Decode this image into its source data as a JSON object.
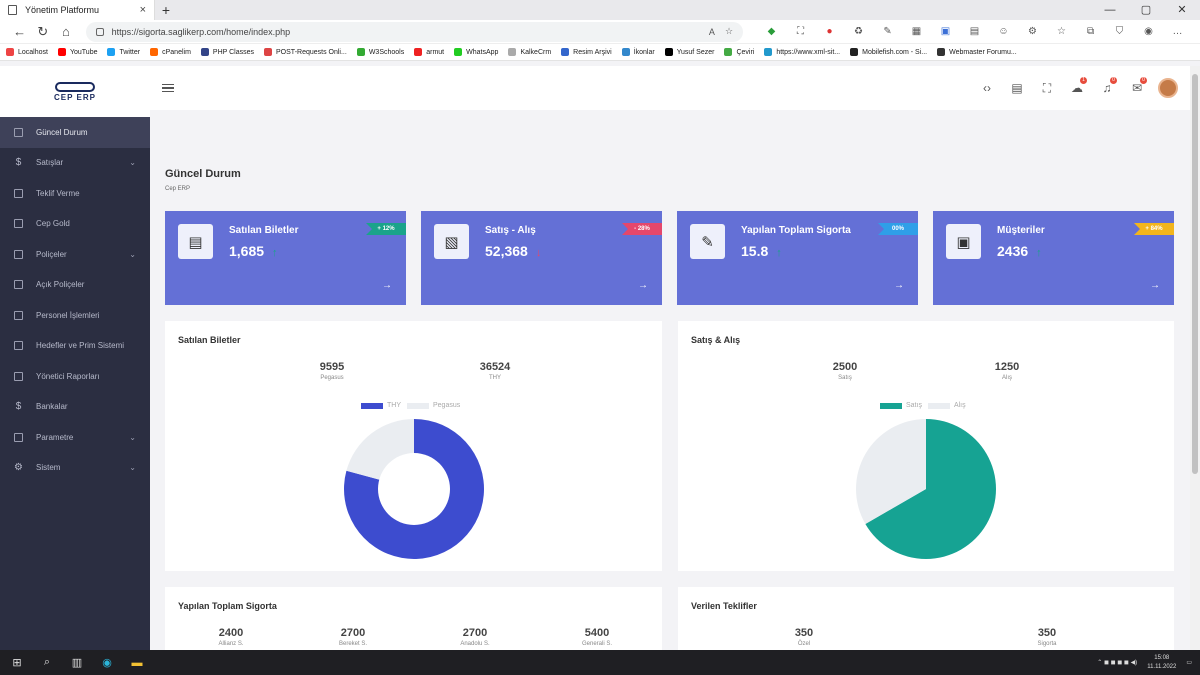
{
  "browser": {
    "tab_title": "Yönetim Platformu",
    "url": "https://sigorta.saglikerp.com/home/index.php",
    "reader_mode": "A",
    "bookmarks": [
      "Localhost",
      "YouTube",
      "Twitter",
      "cPanelim",
      "PHP Classes",
      "POST-Requests Onli...",
      "W3Schools",
      "armut",
      "WhatsApp",
      "KalkeCrm",
      "Resim Arşivi",
      "İkonlar",
      "Yusuf Sezer",
      "Çeviri",
      "https://www.xml-sit...",
      "Mobilefish.com - Si...",
      "Webmaster Forumu..."
    ]
  },
  "app": {
    "logo_text": "CEP ERP",
    "sidebar": [
      {
        "label": "Güncel Durum",
        "icon": "document-icon",
        "chevron": false
      },
      {
        "label": "Satışlar",
        "icon": "dollar-icon",
        "chevron": true
      },
      {
        "label": "Teklif Verme",
        "icon": "document-icon",
        "chevron": false
      },
      {
        "label": "Cep Gold",
        "icon": "document-icon",
        "chevron": false
      },
      {
        "label": "Poliçeler",
        "icon": "document-icon",
        "chevron": true
      },
      {
        "label": "Açık Poliçeler",
        "icon": "document-icon",
        "chevron": false
      },
      {
        "label": "Personel İşlemleri",
        "icon": "document-icon",
        "chevron": false
      },
      {
        "label": "Hedefler ve Prim Sistemi",
        "icon": "document-icon",
        "chevron": false
      },
      {
        "label": "Yönetici Raporları",
        "icon": "document-icon",
        "chevron": false
      },
      {
        "label": "Bankalar",
        "icon": "dollar-icon",
        "chevron": false
      },
      {
        "label": "Parametre",
        "icon": "card-icon",
        "chevron": true
      },
      {
        "label": "Sistem",
        "icon": "gear-icon",
        "chevron": true
      }
    ],
    "topbar_badges": {
      "bell": "0",
      "mail": "0",
      "cloud": "1"
    }
  },
  "page": {
    "title": "Güncel Durum",
    "subtitle": "Cep ERP"
  },
  "cards": [
    {
      "title": "Satılan Biletler",
      "value": "1,685",
      "trend": "↑",
      "badge": "+ 12%",
      "badge_color": "#1aa38a",
      "trend_color": "#1aa38a"
    },
    {
      "title": "Satış - Alış",
      "value": "52,368",
      "trend": "↓",
      "badge": "- 28%",
      "badge_color": "#e5476b",
      "trend_color": "#e5476b"
    },
    {
      "title": "Yapılan Toplam Sigorta",
      "value": "15.8",
      "trend": "↑",
      "badge": "00%",
      "badge_color": "#2f9fe8",
      "trend_color": "#1aa38a"
    },
    {
      "title": "Müşteriler",
      "value": "2436",
      "trend": "↑",
      "badge": "+ 84%",
      "badge_color": "#f2b51d",
      "trend_color": "#1aa38a"
    }
  ],
  "panels": {
    "tickets": {
      "title": "Satılan Biletler",
      "stats": [
        {
          "value": "9595",
          "label": "Pegasus"
        },
        {
          "value": "36524",
          "label": "THY"
        }
      ],
      "legend": [
        {
          "label": "THY",
          "color": "#3d4ccf"
        },
        {
          "label": "Pegasus",
          "color": "#eaedf1"
        }
      ]
    },
    "sales": {
      "title": "Satış & Alış",
      "stats": [
        {
          "value": "2500",
          "label": "Satış"
        },
        {
          "value": "1250",
          "label": "Alış"
        }
      ],
      "legend": [
        {
          "label": "Satış",
          "color": "#16a393"
        },
        {
          "label": "Alış",
          "color": "#eaedf1"
        }
      ]
    },
    "insurance": {
      "title": "Yapılan Toplam Sigorta",
      "stats": [
        {
          "value": "2400",
          "label": "Allianz S."
        },
        {
          "value": "2700",
          "label": "Bereket S."
        },
        {
          "value": "2700",
          "label": "Anadolu S."
        },
        {
          "value": "5400",
          "label": "Generali S."
        }
      ]
    },
    "offers": {
      "title": "Verilen Teklifler",
      "stats": [
        {
          "value": "350",
          "label": "Özel"
        },
        {
          "value": "350",
          "label": "Sigorta"
        }
      ]
    }
  },
  "chart_data": [
    {
      "type": "pie",
      "title": "Satılan Biletler",
      "categories": [
        "THY",
        "Pegasus"
      ],
      "values": [
        36524,
        9595
      ],
      "colors": [
        "#3d4ccf",
        "#eaedf1"
      ],
      "donut": true
    },
    {
      "type": "pie",
      "title": "Satış & Alış",
      "categories": [
        "Satış",
        "Alış"
      ],
      "values": [
        2500,
        1250
      ],
      "colors": [
        "#16a393",
        "#eaedf1"
      ],
      "donut": false
    }
  ],
  "taskbar": {
    "time": "15:08",
    "date": "11.11.2022"
  }
}
